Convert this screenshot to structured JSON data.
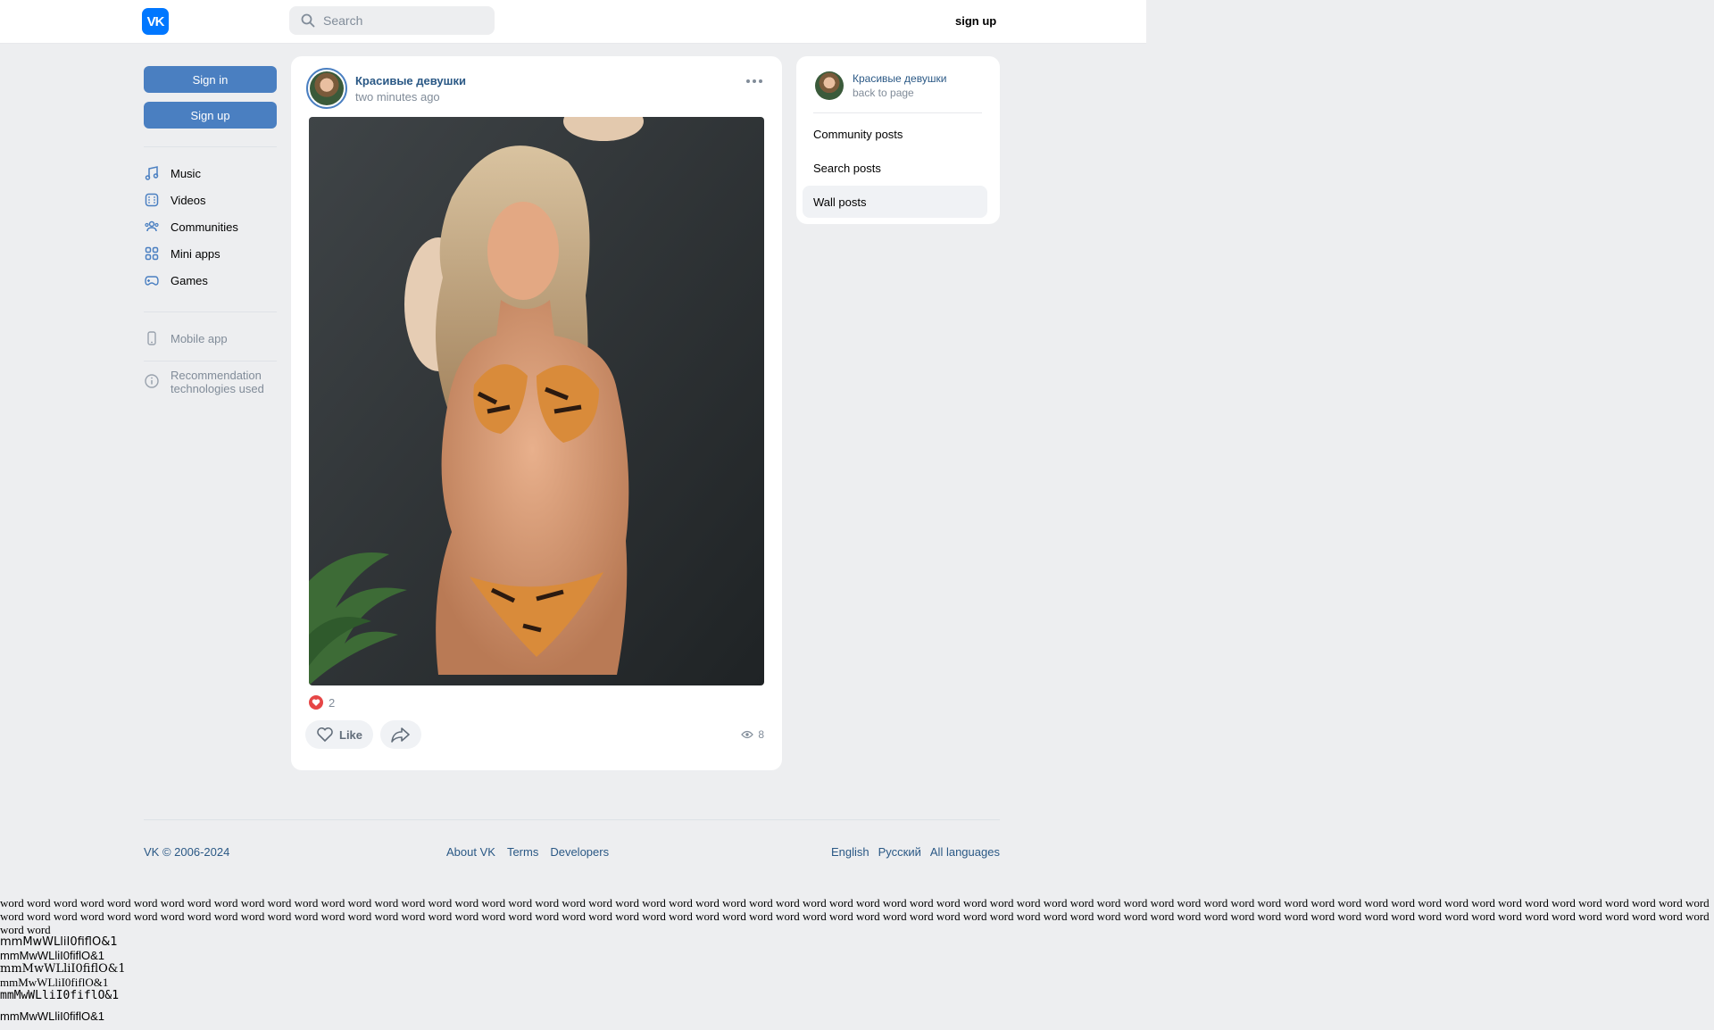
{
  "header": {
    "logo": "VK",
    "search_placeholder": "Search",
    "signup_label": "sign up"
  },
  "sidebar": {
    "signin_label": "Sign in",
    "signup_label": "Sign up",
    "items": [
      {
        "label": "Music",
        "icon": "music-icon"
      },
      {
        "label": "Videos",
        "icon": "video-icon"
      },
      {
        "label": "Communities",
        "icon": "communities-icon"
      },
      {
        "label": "Mini apps",
        "icon": "mini-apps-icon"
      },
      {
        "label": "Games",
        "icon": "games-icon"
      }
    ],
    "mobile_app": "Mobile app",
    "recommendation": "Recommendation technologies used"
  },
  "post": {
    "author": "Красивые девушки",
    "time": "two minutes ago",
    "likes": "2",
    "like_label": "Like",
    "views": "8"
  },
  "right_panel": {
    "name": "Красивые девушки",
    "back": "back to page",
    "items": [
      "Community posts",
      "Search posts",
      "Wall posts"
    ],
    "active_index": 2
  },
  "footer": {
    "copyright": "VK © 2006-2024",
    "links": [
      "About VK",
      "Terms",
      "Developers"
    ],
    "languages": [
      "English",
      "Русский",
      "All languages"
    ]
  },
  "debug": {
    "words": "word word word word word word word word word word word word word word word word word word word word word word word word word word word word word word word word word word word word word word word word word word word word word word word word word word word word word word word word word word word word word word word word word word word word word word word word word word word word word word word word word word word word word word word word word word word word word word word word word word word word word word word word word word word word word word word word word word word word word word word word word word word word word word word word word word",
    "font_samples": [
      "mmMwWLliI0fiflO&1",
      "mmMwWLliI0fiflO&1",
      "mmMwWLliI0fiflO&1",
      "mmMwWLliI0fiflO&1",
      "mmMwWLliI0fiflO&1",
      "mmMwWLliI0fiflO&1"
    ]
  },
  "colors": {
    "brand": "#0077ff",
    "button": "#4a7fc1",
    "link": "#2a5885",
    "muted": "#818c99",
    "background": "#edeef0"
  }
}
